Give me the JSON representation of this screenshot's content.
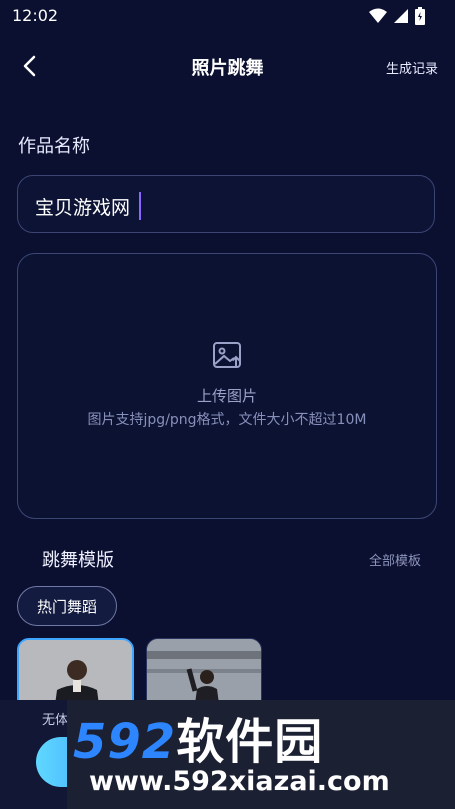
{
  "status": {
    "time": "12:02"
  },
  "nav": {
    "title": "照片跳舞",
    "history": "生成记录"
  },
  "form": {
    "name_label": "作品名称",
    "name_value": "宝贝游戏网",
    "upload_title": "上传图片",
    "upload_hint": "图片支持jpg/png格式，文件大小不超过10M"
  },
  "templates": {
    "title": "跳舞模版",
    "all_label": "全部模板",
    "chip": "热门舞蹈"
  },
  "bottom": {
    "option_label": "无体"
  },
  "watermark": {
    "logo_num": "592",
    "logo_text": "软件园",
    "url": "www.592xiazai.com"
  },
  "colors": {
    "background": "#0b1030",
    "accent": "#3fa6ff",
    "border": "#3b4675"
  }
}
